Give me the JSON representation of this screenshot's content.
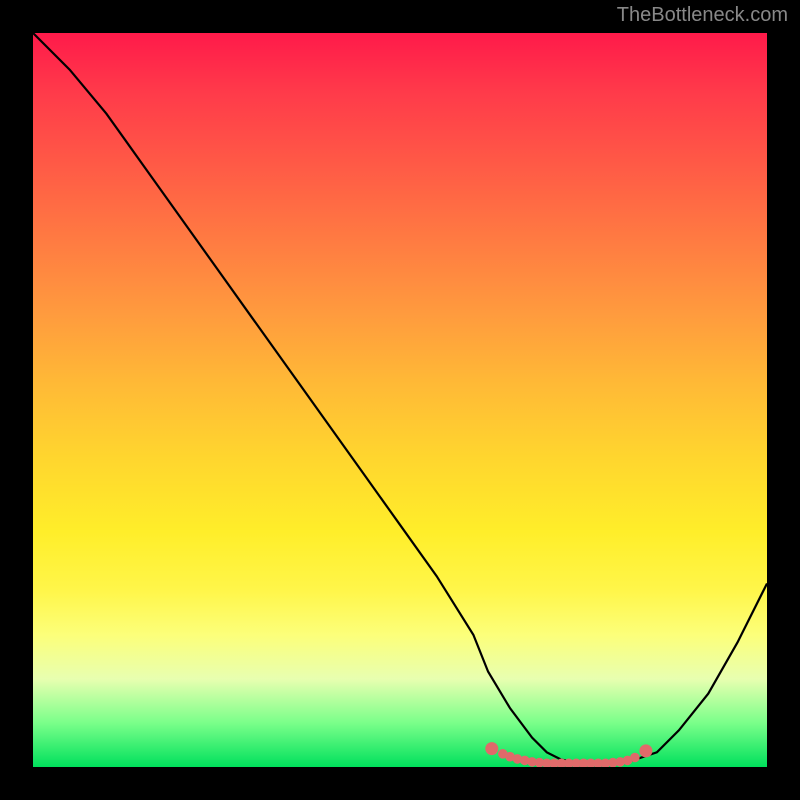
{
  "attribution": "TheBottleneck.com",
  "chart_data": {
    "type": "line",
    "title": "",
    "xlabel": "",
    "ylabel": "",
    "xlim": [
      0,
      100
    ],
    "ylim": [
      0,
      100
    ],
    "series": [
      {
        "name": "bottleneck-curve",
        "x": [
          0,
          5,
          10,
          15,
          20,
          25,
          30,
          35,
          40,
          45,
          50,
          55,
          60,
          62,
          65,
          68,
          70,
          72,
          75,
          78,
          80,
          82,
          85,
          88,
          92,
          96,
          100
        ],
        "y": [
          100,
          95,
          89,
          82,
          75,
          68,
          61,
          54,
          47,
          40,
          33,
          26,
          18,
          13,
          8,
          4,
          2,
          1,
          0.5,
          0.5,
          0.5,
          1,
          2,
          5,
          10,
          17,
          25
        ]
      }
    ],
    "markers": {
      "name": "optimal-range-dots",
      "x": [
        62.5,
        64,
        65,
        66,
        67,
        68,
        69,
        70,
        71,
        72,
        73,
        74,
        75,
        76,
        77,
        78,
        79,
        80,
        81,
        82,
        83.5
      ],
      "y": [
        2.5,
        1.8,
        1.4,
        1.1,
        0.9,
        0.7,
        0.6,
        0.5,
        0.5,
        0.5,
        0.5,
        0.5,
        0.5,
        0.5,
        0.5,
        0.5,
        0.6,
        0.7,
        0.9,
        1.3,
        2.2
      ]
    },
    "gradient_stops": [
      {
        "pos": 0,
        "color": "#ff1a4a"
      },
      {
        "pos": 50,
        "color": "#ffd62e"
      },
      {
        "pos": 82,
        "color": "#fcff7a"
      },
      {
        "pos": 100,
        "color": "#00e05c"
      }
    ]
  }
}
